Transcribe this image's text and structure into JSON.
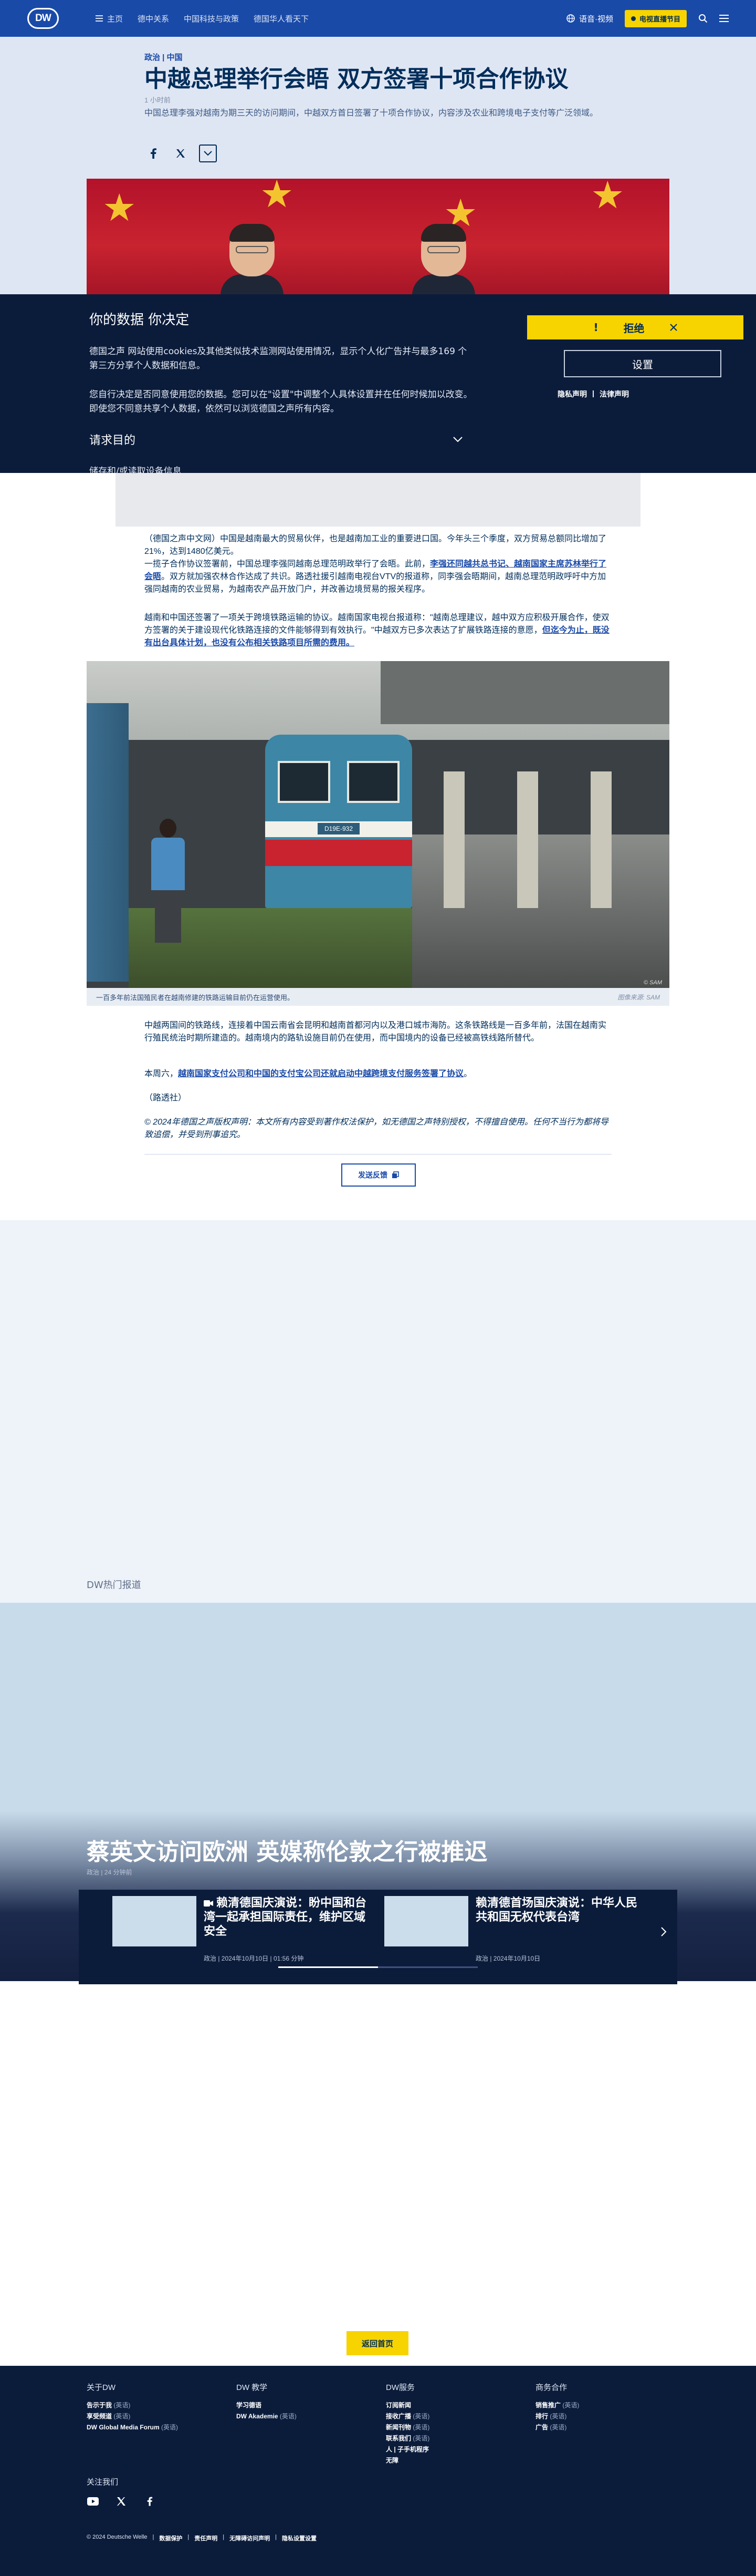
{
  "header": {
    "logo": "DW",
    "nav": [
      "主页",
      "德中关系",
      "中国科技与政策",
      "德国华人看天下"
    ],
    "language": "语音·视频",
    "live": "电视直播节目"
  },
  "article": {
    "kicker": "政治 | 中国",
    "title": "中越总理举行会晤 双方签署十项合作协议",
    "date": "1 小时前",
    "summary": "中国总理李强对越南为期三天的访问期间，中越双方首日签署了十项合作协议，内容涉及农业和跨境电子支付等广泛领域。"
  },
  "consent": {
    "title": "你的数据 你决定",
    "p1": "德国之声 网站使用cookies及其他类似技术监测网站使用情况，显示个人化广告并与最多169 个第三方分享个人数据和信息。",
    "p2": "您自行决定是否同意使用您的数据。您可以在\"设置\"中调整个人具体设置并在任何时候加以改变。即使您不同意共享个人数据，依然可以浏览德国之声所有内容。",
    "reject": "拒绝",
    "settings": "设置",
    "privacy": "隐私声明",
    "legal": "法律声明",
    "purposes": "请求目的",
    "purpose_cut": "储存和/或读取设备信息"
  },
  "body": {
    "p1a": "（德国之声中文网）中国是越南最大的贸易伙伴，也是越南加工业的重要进口国。今年头三个季度，双方贸易总额同比增加了21%，达到1480亿美元。",
    "p1b": "一揽子合作协议签署前，中国总理李强同越南总理范明政举行了会晤。此前，",
    "link1": "李强还同越共总书记、越南国家主席苏林举行了会晤",
    "p1c": "。双方就加强农林合作达成了共识。路透社援引越南电视台VTV的报道称，同李强会晤期间，越南总理范明政呼吁中方加强同越南的农业贸易，为越南农产品开放门户，并改善边境贸易的报关程序。",
    "p2a": "越南和中国还签署了一项关于跨境铁路运输的协议。越南国家电视台报道称：\"越南总理建议，越中双方应积极开展合作，使双方签署的关于建设现代化铁路连接的文件能够得到有效执行。\"中越双方已多次表达了扩展铁路连接的意愿，",
    "link2": "但迄今为止，既没有出台具体计划，也没有公布相关铁路项目所需的费用。",
    "caption": "一百多年前法国殖民者在越南修建的铁路运输目前仍在运营使用。",
    "credit": "图像来源: SAM",
    "fig_credit": "© SAM",
    "plate": "D19E-932",
    "p3": "中越两国间的铁路线，连接着中国云南省会昆明和越南首都河内以及港口城市海防。这条铁路线是一百多年前，法国在越南实行殖民统治时期所建造的。越南境内的路轨设施目前仍在使用，而中国境内的设备已经被高铁线路所替代。",
    "p4a": "本周六，",
    "link3": "越南国家支付公司和中国的支付宝公司还就启动中越跨境支付服务签署了协议",
    "p4b": "。",
    "p5": "（路透社）",
    "p6": "© 2024年德国之声版权声明：本文所有内容受到著作权法保护，如无德国之声特别授权，不得擅自使用。任何不当行为都将导致追偿，并受到刑事追究。",
    "feedback": "发送反馈"
  },
  "hot": {
    "label": "DW热门报道",
    "headline": "蔡英文访问欧洲 英媒称伦敦之行被推迟",
    "meta": "政治 | 24 分钟前",
    "cards": [
      {
        "title": "赖清德国庆演说：盼中国和台湾一起承担国际责任，维护区域安全",
        "meta": "政治 | 2024年10月10日 | 01:56 分钟"
      },
      {
        "title": "赖清德首场国庆演说：中华人民共和国无权代表台湾",
        "meta": "政治 | 2024年10月10日"
      }
    ]
  },
  "home": "返回首页",
  "footer": {
    "cols": [
      {
        "title": "关于DW",
        "links": [
          {
            "t": "告示于我",
            "e": "(英语)"
          },
          {
            "t": "享受频道",
            "e": "(英语)"
          },
          {
            "t": "DW Global Media Forum",
            "e": "(英语)"
          }
        ]
      },
      {
        "title": "DW 教学",
        "links": [
          {
            "t": "学习德语",
            "e": ""
          },
          {
            "t": "DW Akademie",
            "e": "(英语)"
          }
        ]
      },
      {
        "title": "DW服务",
        "links": [
          {
            "t": "订阅新闻",
            "e": ""
          },
          {
            "t": "接收广播",
            "e": "(英语)"
          },
          {
            "t": "新闻刊物",
            "e": "(英语)"
          },
          {
            "t": "联系我们",
            "e": "(英语)"
          },
          {
            "t": "人 | 子手机程序",
            "e": ""
          },
          {
            "t": "无障",
            "e": ""
          }
        ]
      },
      {
        "title": "商务合作",
        "links": [
          {
            "t": "销售推广",
            "e": "(英语)"
          },
          {
            "t": "排行",
            "e": "(英语)"
          },
          {
            "t": "广告",
            "e": "(英语)"
          }
        ]
      }
    ],
    "follow": "关注我们",
    "copyright": "© 2024 Deutsche Welle",
    "legal": [
      "数据保护",
      "责任声明",
      "无障碍访问声明",
      "隐私设置设置"
    ]
  }
}
